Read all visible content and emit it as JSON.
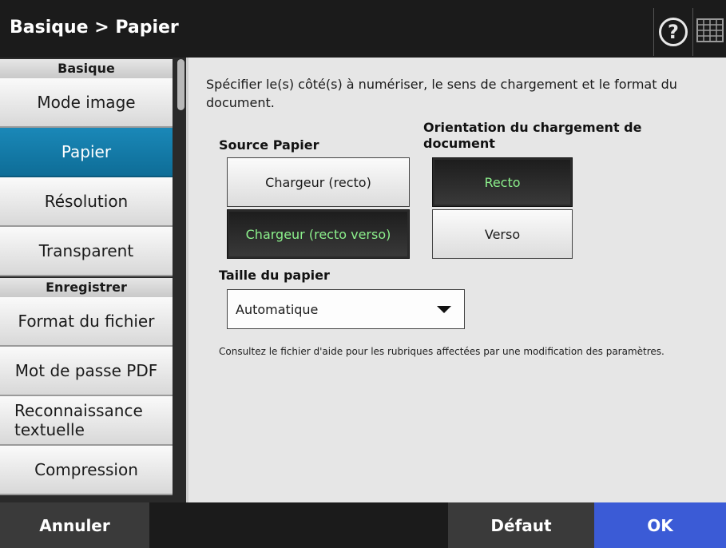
{
  "header": {
    "title": "Basique > Papier",
    "help_icon": "question-circle-icon",
    "keyboard_icon": "keyboard-icon"
  },
  "sidebar": {
    "section_basic": "Basique",
    "section_save": "Enregistrer",
    "items": [
      {
        "label": "Mode image"
      },
      {
        "label": "Papier"
      },
      {
        "label": "Résolution"
      },
      {
        "label": "Transparent"
      },
      {
        "label": "Format du fichier"
      },
      {
        "label": "Mot de passe PDF"
      },
      {
        "label": "Reconnaissance textuelle"
      },
      {
        "label": "Compression"
      }
    ]
  },
  "main": {
    "description": "Spécifier le(s) côté(s) à numériser, le sens de chargement et le format du document.",
    "source_label": "Source Papier",
    "source_options": [
      "Chargeur (recto)",
      "Chargeur (recto verso)"
    ],
    "orientation_label": "Orientation du chargement de document",
    "orientation_options": [
      "Recto",
      "Verso"
    ],
    "size_label": "Taille du papier",
    "size_value": "Automatique",
    "note": "Consultez le fichier d'aide pour les rubriques affectées par une modification des paramètres."
  },
  "footer": {
    "cancel": "Annuler",
    "default": "Défaut",
    "ok": "OK"
  },
  "colors": {
    "active_tab": "#0e6d97",
    "selected_text": "#8cf08c",
    "ok_button": "#3b5bd6"
  }
}
